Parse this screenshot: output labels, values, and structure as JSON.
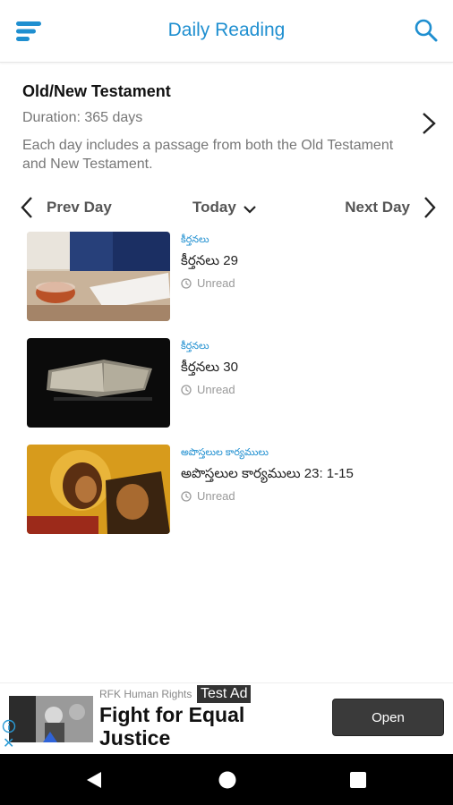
{
  "header": {
    "title": "Daily Reading",
    "menu_icon": "hamburger-menu-icon",
    "search_icon": "search-icon"
  },
  "plan": {
    "title": "Old/New Testament",
    "duration": "Duration: 365 days",
    "description": "Each day includes a passage from both the Old Testament and New Testament."
  },
  "day_nav": {
    "prev_label": "Prev Day",
    "today_label": "Today",
    "next_label": "Next Day"
  },
  "readings": [
    {
      "book": "కీర్తనలు",
      "passage": "కీర్తనలు 29",
      "status": "Unread",
      "image": "tea-cup-and-open-bible"
    },
    {
      "book": "కీర్తనలు",
      "passage": "కీర్తనలు 30",
      "status": "Unread",
      "image": "open-book-in-dark"
    },
    {
      "book": "అపొస్తలుల కార్యములు",
      "passage": "అపొస్తలుల కార్యములు 23: 1-15",
      "status": "Unread",
      "image": "painted-icon-artwork"
    }
  ],
  "ad": {
    "advertiser": "RFK Human Rights",
    "badge": "Test Ad",
    "headline": "Fight for Equal Justice",
    "cta": "Open"
  },
  "colors": {
    "accent": "#1f8fd0",
    "muted_text": "#777777",
    "navbar": "#000000"
  }
}
